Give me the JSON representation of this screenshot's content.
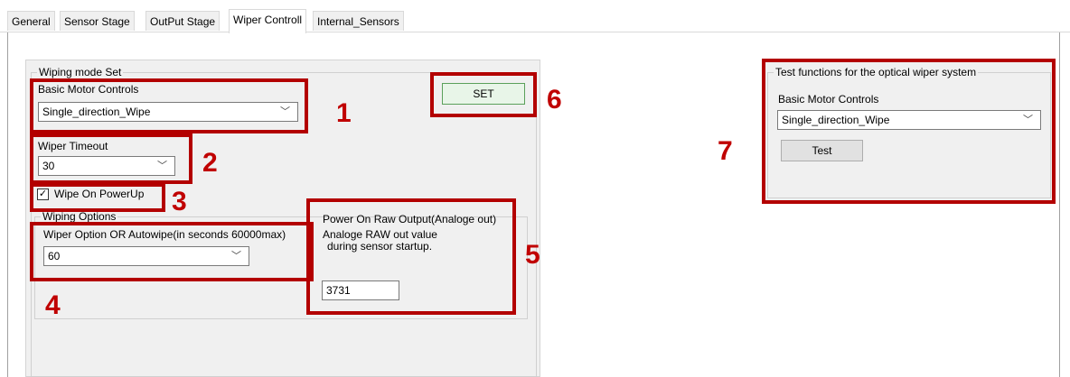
{
  "tabs": [
    "General",
    "Sensor Stage",
    "OutPut Stage",
    "Wiper Controll",
    "Internal_Sensors"
  ],
  "left": {
    "wiping_mode_title": "Wiping mode Set",
    "basic_motor_label": "Basic Motor Controls",
    "basic_motor_value": "Single_direction_Wipe",
    "set_button": "SET",
    "wiper_timeout_label": "Wiper Timeout",
    "wiper_timeout_value": "30",
    "wipe_on_powerup_label": "Wipe On PowerUp",
    "wipe_on_powerup_checked": true,
    "wiping_options_title": "Wiping Options",
    "wiper_option_label": "Wiper Option OR Autowipe(in seconds 60000max)",
    "wiper_option_value": "60",
    "power_on_title": "Power On Raw Output(Analoge out)",
    "power_on_desc1": "Analoge RAW out value",
    "power_on_desc2": "during sensor startup.",
    "power_on_value": "3731"
  },
  "right": {
    "title": "Test functions for the optical wiper system",
    "basic_motor_label": "Basic Motor Controls",
    "basic_motor_value": "Single_direction_Wipe",
    "test_button": "Test"
  },
  "annotations": [
    "1",
    "2",
    "3",
    "4",
    "5",
    "6",
    "7"
  ],
  "colors": {
    "annotation": "#b30000",
    "set_button_bg": "#e8f5e8"
  },
  "icons": {
    "dropdown": "chevron-down-icon",
    "check": "checkmark-icon"
  }
}
